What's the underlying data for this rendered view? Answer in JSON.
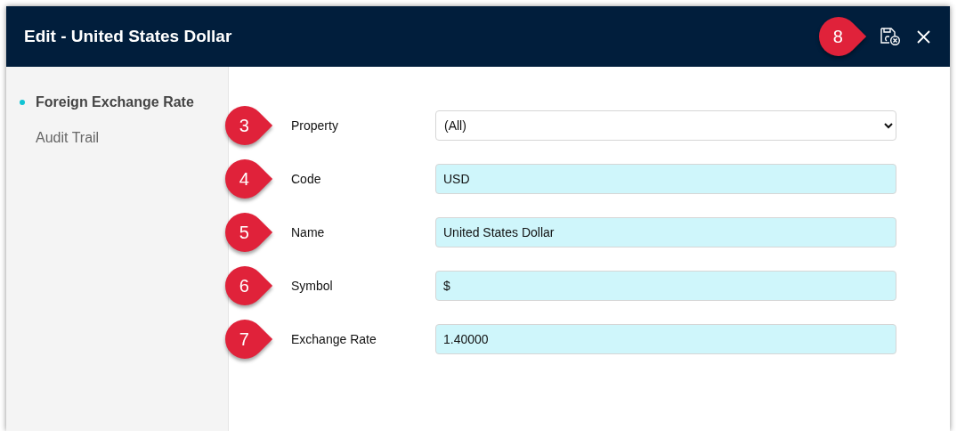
{
  "window": {
    "title": "Edit - United States Dollar",
    "callout": "8"
  },
  "sidebar": {
    "items": [
      {
        "label": "Foreign Exchange Rate",
        "selected": true
      },
      {
        "label": "Audit Trail",
        "selected": false
      }
    ]
  },
  "form": {
    "fields": [
      {
        "callout": "3",
        "label": "Property",
        "kind": "select",
        "value": "(All)"
      },
      {
        "callout": "4",
        "label": "Code",
        "kind": "text",
        "value": "USD"
      },
      {
        "callout": "5",
        "label": "Name",
        "kind": "text",
        "value": "United States Dollar"
      },
      {
        "callout": "6",
        "label": "Symbol",
        "kind": "text",
        "value": "$"
      },
      {
        "callout": "7",
        "label": "Exchange Rate",
        "kind": "text",
        "value": "1.40000"
      }
    ]
  }
}
